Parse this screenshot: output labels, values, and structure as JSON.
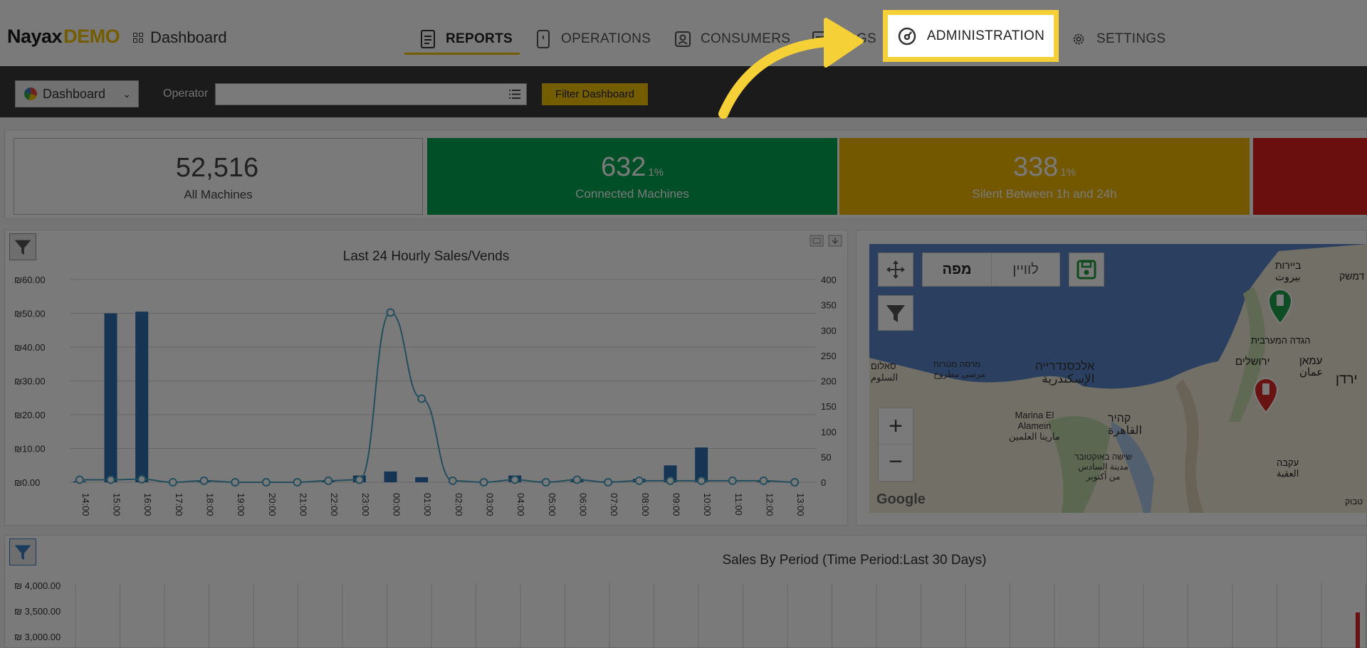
{
  "logo": {
    "brand": "Nayax",
    "demo": "DEMO"
  },
  "breadcrumb": "Dashboard",
  "nav": [
    {
      "label": "REPORTS",
      "icon": "report-icon",
      "active": true
    },
    {
      "label": "OPERATIONS",
      "icon": "tablet-icon"
    },
    {
      "label": "CONSUMERS",
      "icon": "consumer-icon"
    },
    {
      "label": "LOGS",
      "icon": "logs-icon"
    },
    {
      "label": "ADMINISTRATION",
      "icon": "gauge-icon"
    },
    {
      "label": "SETTINGS",
      "icon": "gear-icon"
    }
  ],
  "filterbar": {
    "dashboard_select": "Dashboard",
    "operator_label": "Operator",
    "operator_value": "",
    "filter_button": "Filter Dashboard"
  },
  "kpis": [
    {
      "value": "52,516",
      "pct": "",
      "label": "All Machines",
      "color": "#ffffff"
    },
    {
      "value": "632",
      "pct": "1%",
      "label": "Connected Machines",
      "color": "#00a551"
    },
    {
      "value": "338",
      "pct": "1%",
      "label": "Silent Between 1h and 24h",
      "color": "#f2b800"
    },
    {
      "value": "",
      "pct": "",
      "label": "",
      "color": "#e01f1f"
    }
  ],
  "hourly_chart": {
    "title": "Last 24 Hourly Sales/Vends",
    "left_ticks": [
      "₪60.00",
      "₪50.00",
      "₪40.00",
      "₪30.00",
      "₪20.00",
      "₪10.00",
      "₪0.00"
    ],
    "right_ticks": [
      "400",
      "350",
      "300",
      "250",
      "200",
      "150",
      "100",
      "50",
      "0"
    ]
  },
  "chart_data": [
    {
      "type": "bar",
      "title": "Last 24 Hourly Sales/Vends",
      "categories": [
        "14:00",
        "15:00",
        "16:00",
        "17:00",
        "18:00",
        "19:00",
        "20:00",
        "21:00",
        "22:00",
        "23:00",
        "00:00",
        "01:00",
        "02:00",
        "03:00",
        "04:00",
        "05:00",
        "06:00",
        "07:00",
        "08:00",
        "09:00",
        "10:00",
        "11:00",
        "12:00",
        "13:00"
      ],
      "series": [
        {
          "values": [
            0.3,
            50,
            50.5,
            0,
            0.3,
            0,
            0,
            0,
            0.3,
            2,
            3.2,
            1.5,
            0,
            0,
            2,
            0.3,
            1,
            0.3,
            1,
            5,
            10.3,
            0,
            0.3,
            0
          ]
        },
        {
          "values": [
            5,
            5,
            6,
            0,
            3,
            0,
            0,
            0,
            3,
            5,
            335,
            165,
            3,
            0,
            5,
            0,
            5,
            0,
            3,
            3,
            3,
            3,
            3,
            0
          ]
        }
      ],
      "ylim": [
        0,
        60
      ],
      "y2lim": [
        0,
        400
      ]
    },
    {
      "type": "bar",
      "title": "Sales By Period (Time Period:Last 30 Days)",
      "categories": [],
      "values": [],
      "ylim": [
        0,
        4000
      ]
    }
  ],
  "map": {
    "tab_map": "מפה",
    "tab_satellite": "לוויין",
    "place_labels": [
      "אלכסנדרייה",
      "الإسكندرية",
      "מרסה מטרוח",
      "مرسى مطروح",
      "סאלום",
      "السلوم",
      "Marina El",
      "Alamein",
      "مارينا العلمين",
      "קהיר",
      "القاهرة",
      "שישה באוקטובר",
      "مدينة السادس",
      "من أكتوبر",
      "ירושלים",
      "עמאן",
      "عمان",
      "ירדן",
      "הגדה המערבית",
      "ביירות",
      "بيروت",
      "עקבה",
      "العقبة",
      "דמשק",
      "טבוק"
    ],
    "attribution": "Google"
  },
  "sales_period": {
    "title": "Sales By Period (Time Period:Last 30 Days)",
    "ticks": [
      "₪ 4,000.00",
      "₪ 3,500.00",
      "₪ 3,000.00"
    ]
  }
}
